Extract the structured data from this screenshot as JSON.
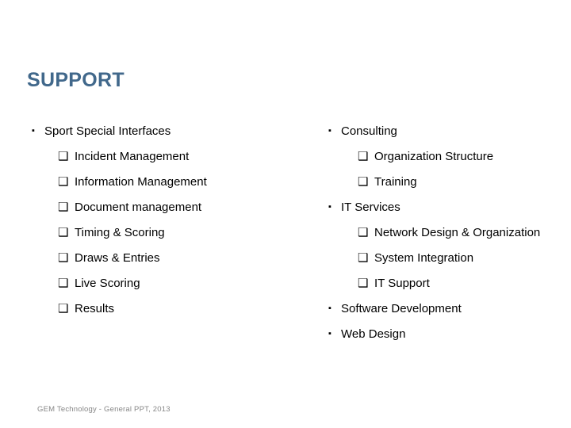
{
  "slide": {
    "title": "SUPPORT",
    "title_color": "#41688B",
    "background_color": "#FFFFFF",
    "text_color": "#000000"
  },
  "bullet_glyphs": {
    "level_1": "▪",
    "level_2": "❑"
  },
  "columns": {
    "left": {
      "items": [
        {
          "level": 1,
          "label": "Sport Special Interfaces"
        },
        {
          "level": 2,
          "label": "Incident Management"
        },
        {
          "level": 2,
          "label": "Information Management"
        },
        {
          "level": 2,
          "label": "Document management"
        },
        {
          "level": 2,
          "label": "Timing & Scoring"
        },
        {
          "level": 2,
          "label": "Draws & Entries"
        },
        {
          "level": 2,
          "label": "Live Scoring"
        },
        {
          "level": 2,
          "label": "Results"
        }
      ]
    },
    "right": {
      "items": [
        {
          "level": 1,
          "label": "Consulting"
        },
        {
          "level": 2,
          "label": "Organization Structure"
        },
        {
          "level": 2,
          "label": "Training"
        },
        {
          "level": 1,
          "label": "IT Services"
        },
        {
          "level": 2,
          "label": "Network Design & Organization"
        },
        {
          "level": 2,
          "label": "System Integration"
        },
        {
          "level": 2,
          "label": "IT Support"
        },
        {
          "level": 1,
          "label": "Software Development"
        },
        {
          "level": 1,
          "label": "Web Design"
        }
      ]
    }
  },
  "footer": {
    "text": "GEM Technology - General PPT, 2013",
    "color": "#878787"
  }
}
